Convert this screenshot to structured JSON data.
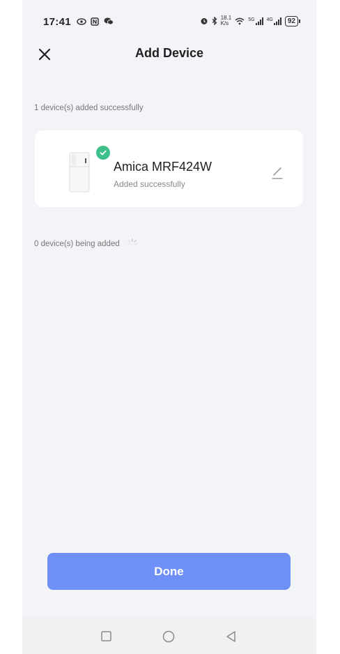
{
  "status_bar": {
    "time": "17:41",
    "left_icons": [
      "eye-icon",
      "nfc-icon",
      "wechat-icon"
    ],
    "right_icons": [
      "alarm-icon",
      "bluetooth-icon",
      "wifi-icon",
      "signal-5g-icon",
      "signal-4g-icon"
    ],
    "net_speed_top": "18.1",
    "net_speed_bottom": "K/s",
    "sig1_label": "5G",
    "sig2_label": "4G",
    "battery": "92"
  },
  "header": {
    "title": "Add Device",
    "close_icon": "close-icon"
  },
  "added_section": {
    "label": "1 device(s) added successfully",
    "devices": [
      {
        "name": "Amica MRF424W",
        "status": "Added successfully",
        "icon": "fridge-icon",
        "badge_icon": "check-icon",
        "badge_color": "#3dbf8a"
      }
    ]
  },
  "adding_section": {
    "label": "0 device(s) being added",
    "icon": "loading-spinner-icon"
  },
  "done_button": {
    "label": "Done",
    "color": "#6e8ff5"
  },
  "nav_bar": {
    "icons": [
      "recents-square-icon",
      "home-circle-icon",
      "back-triangle-icon"
    ]
  }
}
